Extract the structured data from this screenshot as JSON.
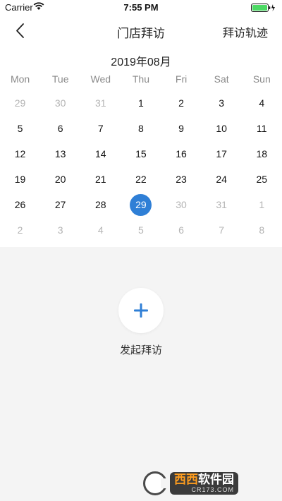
{
  "status_bar": {
    "carrier": "Carrier",
    "time": "7:55 PM"
  },
  "nav": {
    "title": "门店拜访",
    "right_action": "拜访轨迹"
  },
  "calendar": {
    "month_label": "2019年08月",
    "weekdays": [
      "Mon",
      "Tue",
      "Wed",
      "Thu",
      "Fri",
      "Sat",
      "Sun"
    ],
    "weeks": [
      [
        {
          "d": "29",
          "m": true
        },
        {
          "d": "30",
          "m": true
        },
        {
          "d": "31",
          "m": true
        },
        {
          "d": "1"
        },
        {
          "d": "2"
        },
        {
          "d": "3"
        },
        {
          "d": "4"
        }
      ],
      [
        {
          "d": "5"
        },
        {
          "d": "6"
        },
        {
          "d": "7"
        },
        {
          "d": "8"
        },
        {
          "d": "9"
        },
        {
          "d": "10"
        },
        {
          "d": "11"
        }
      ],
      [
        {
          "d": "12"
        },
        {
          "d": "13"
        },
        {
          "d": "14"
        },
        {
          "d": "15"
        },
        {
          "d": "16"
        },
        {
          "d": "17"
        },
        {
          "d": "18"
        }
      ],
      [
        {
          "d": "19"
        },
        {
          "d": "20"
        },
        {
          "d": "21"
        },
        {
          "d": "22"
        },
        {
          "d": "23"
        },
        {
          "d": "24"
        },
        {
          "d": "25"
        }
      ],
      [
        {
          "d": "26"
        },
        {
          "d": "27"
        },
        {
          "d": "28"
        },
        {
          "d": "29",
          "s": true
        },
        {
          "d": "30",
          "m": true
        },
        {
          "d": "31",
          "m": true
        },
        {
          "d": "1",
          "m": true
        }
      ],
      [
        {
          "d": "2",
          "m": true
        },
        {
          "d": "3",
          "m": true
        },
        {
          "d": "4",
          "m": true
        },
        {
          "d": "5",
          "m": true
        },
        {
          "d": "6",
          "m": true
        },
        {
          "d": "7",
          "m": true
        },
        {
          "d": "8",
          "m": true
        }
      ]
    ],
    "selected_color": "#2f7fd6"
  },
  "add_visit": {
    "label": "发起拜访",
    "icon": "plus-icon",
    "color": "#2f7fd6"
  },
  "watermark": {
    "brand_a": "西西",
    "brand_b": "软件园",
    "sub": "CR173.COM"
  }
}
